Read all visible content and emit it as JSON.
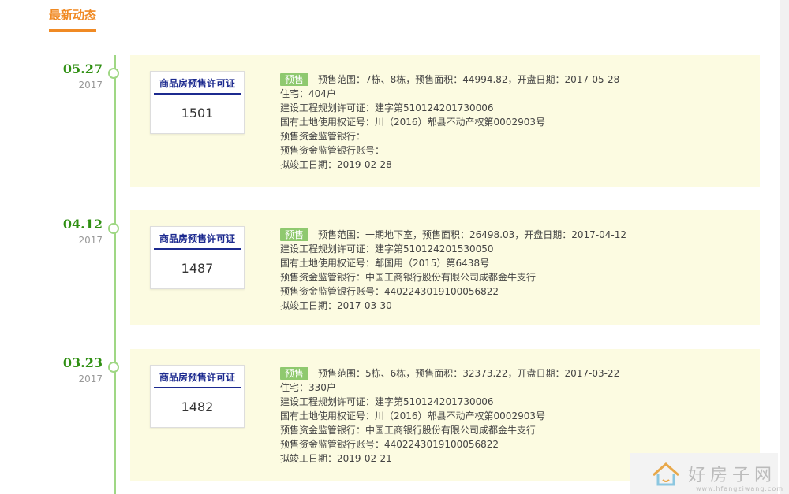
{
  "tab": {
    "label": "最新动态"
  },
  "badge_label": "预售",
  "permit_title": "商品房预售许可证",
  "entries": [
    {
      "date": "05.27",
      "year": "2017",
      "permit_no": "1501",
      "lines": [
        "预售范围：7栋、8栋，预售面积：44994.82，开盘日期：2017-05-28",
        "住宅：404户",
        "建设工程规划许可证：建字第510124201730006",
        "国有土地使用权证号：川（2016）郫县不动产权第0002903号",
        "预售资金监管银行：",
        "预售资金监管银行账号：",
        "拟竣工日期：2019-02-28"
      ]
    },
    {
      "date": "04.12",
      "year": "2017",
      "permit_no": "1487",
      "lines": [
        "预售范围：一期地下室，预售面积：26498.03，开盘日期：2017-04-12",
        "建设工程规划许可证：建字第510124201530050",
        "国有土地使用权证号：郫国用（2015）第6438号",
        "预售资金监管银行：中国工商银行股份有限公司成都金牛支行",
        "预售资金监管银行账号：4402243019100056822",
        "拟竣工日期：2017-03-30"
      ]
    },
    {
      "date": "03.23",
      "year": "2017",
      "permit_no": "1482",
      "lines": [
        "预售范围：5栋、6栋，预售面积：32373.22，开盘日期：2017-03-22",
        "住宅：330户",
        "建设工程规划许可证：建字第510124201730006",
        "国有土地使用权证号：川（2016）郫县不动产权第0002903号",
        "预售资金监管银行：中国工商银行股份有限公司成都金牛支行",
        "预售资金监管银行账号：4402243019100056822",
        "拟竣工日期：2019-02-21"
      ]
    }
  ],
  "watermark": {
    "text": "好房子网",
    "url": "www.hfangziwang.com"
  },
  "colors": {
    "accent": "#f08a24",
    "timeline": "#9fd784",
    "date": "#2f8f12",
    "card": "#fcfbe1",
    "badge": "#8fc96f",
    "permit": "#1c2a8f"
  }
}
